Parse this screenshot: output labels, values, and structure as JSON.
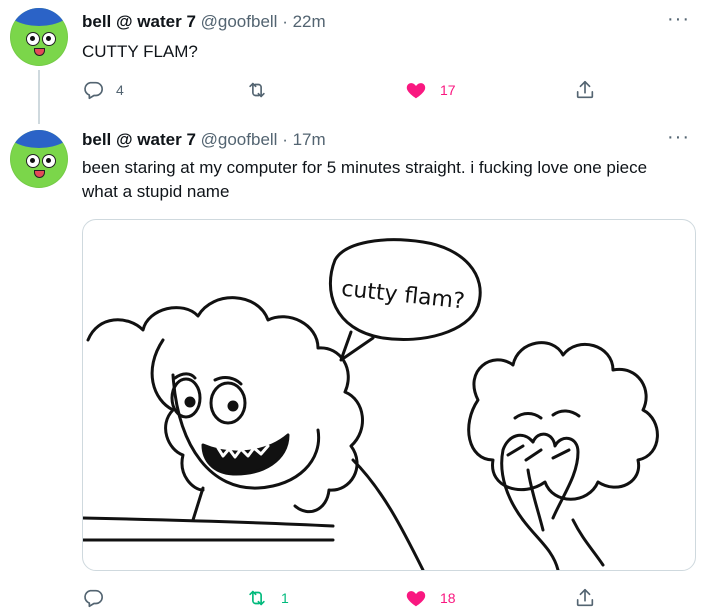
{
  "tweets": [
    {
      "author": {
        "name": "bell @ water 7",
        "handle": "@goofbell"
      },
      "separator": "·",
      "time": "22m",
      "text": "CUTTY FLAM?",
      "actions": {
        "reply_count": "4",
        "retweet_count": "",
        "like_count": "17",
        "liked": true,
        "retweeted": false
      }
    },
    {
      "author": {
        "name": "bell @ water 7",
        "handle": "@goofbell"
      },
      "separator": "·",
      "time": "17m",
      "text": "been staring at my computer for 5 minutes straight. i fucking love one piece\nwhat a stupid name",
      "media": {
        "speech_bubble": "cutty flam?"
      },
      "actions": {
        "reply_count": "",
        "retweet_count": "1",
        "like_count": "18",
        "liked": true,
        "retweeted": true
      }
    }
  ],
  "more_label": "···",
  "colors": {
    "text": "#0f1419",
    "secondary": "#536471",
    "like": "#f91880",
    "retweet": "#00ba7c",
    "border": "#cfd9de",
    "avatar_face": "#7bd64a",
    "avatar_hair": "#2b63c7"
  },
  "icons": [
    "reply-icon",
    "retweet-icon",
    "heart-icon",
    "share-icon",
    "more-icon"
  ]
}
